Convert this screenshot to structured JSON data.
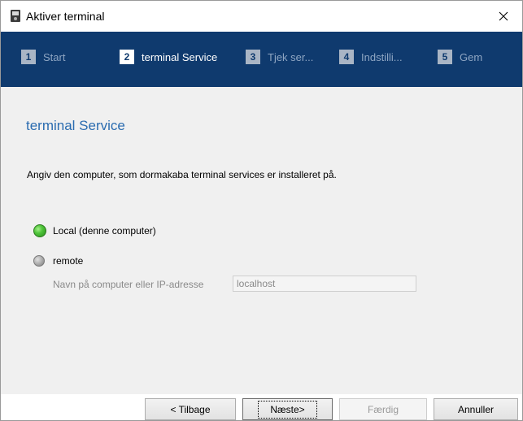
{
  "window": {
    "title": "Aktiver terminal",
    "close_glyph": "✕"
  },
  "steps": [
    {
      "num": "1",
      "label": "Start",
      "active": false
    },
    {
      "num": "2",
      "label": "terminal Service",
      "active": true
    },
    {
      "num": "3",
      "label": "Tjek ser...",
      "active": false
    },
    {
      "num": "4",
      "label": "Indstilli...",
      "active": false
    },
    {
      "num": "5",
      "label": "Gem",
      "active": false
    }
  ],
  "content": {
    "section_title": "terminal Service",
    "instruction": "Angiv den computer, som dormakaba terminal services er installeret på.",
    "option_local": "Local (denne computer)",
    "option_remote": "remote",
    "host_label": "Navn på computer eller IP-adresse",
    "host_value": "localhost"
  },
  "footer": {
    "back": "< Tilbage",
    "next": "Næste>",
    "finish": "Færdig",
    "cancel": "Annuller"
  },
  "colors": {
    "stepsbar": "#0f3a6e",
    "title_accent": "#2b6cb0",
    "radio_selected": "#4fc53a"
  }
}
